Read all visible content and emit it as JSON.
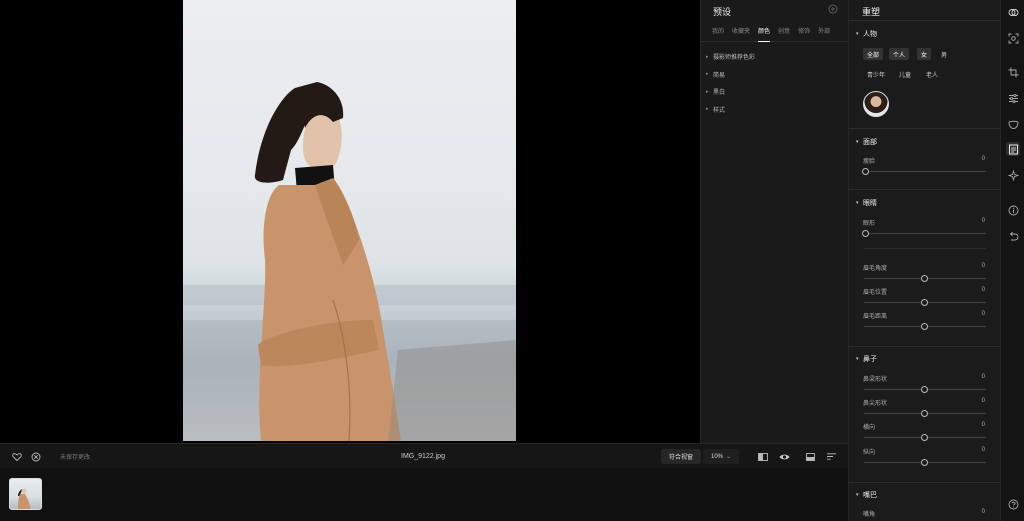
{
  "canvas": {
    "photo_desc_colors": {
      "coat": "#c8926a",
      "hair": "#231a15",
      "sky": "#e8ebed"
    }
  },
  "bottombar": {
    "heart_icon": "heart-icon",
    "reject_icon": "x-circle-icon",
    "unsaved_text": "未保存更改",
    "filename": "IMG_9122.jpg",
    "fit_label": "符合视窗",
    "zoom_label": "10%",
    "zoom_caret": "⌄"
  },
  "presets": {
    "title": "预设",
    "tabs": [
      {
        "label": "我的"
      },
      {
        "label": "收藏夹"
      },
      {
        "label": "颜色"
      },
      {
        "label": "创意"
      },
      {
        "label": "修饰"
      },
      {
        "label": "外部"
      }
    ],
    "items": [
      {
        "label": "摄影师推荐色彩"
      },
      {
        "label": "简易"
      },
      {
        "label": "黑白"
      },
      {
        "label": "样式"
      }
    ]
  },
  "adjust": {
    "title": "重塑",
    "people": {
      "title": "人物",
      "chips_row1": [
        "全部",
        "个人",
        "女",
        "男"
      ],
      "chips_row2": [
        "青少年",
        "儿童",
        "老人"
      ]
    },
    "face": {
      "title": "面部",
      "rows": [
        {
          "label": "瘦脸",
          "value": "0"
        }
      ]
    },
    "eyes": {
      "title": "眼睛",
      "rows": [
        {
          "label": "眼形",
          "value": "0"
        },
        {
          "label": "眉毛角度",
          "value": "0"
        },
        {
          "label": "眉毛位置",
          "value": "0"
        },
        {
          "label": "眉毛距离",
          "value": "0"
        }
      ]
    },
    "nose": {
      "title": "鼻子",
      "rows": [
        {
          "label": "鼻梁形状",
          "value": "0"
        },
        {
          "label": "鼻尖形状",
          "value": "0"
        },
        {
          "label": "横向",
          "value": "0"
        },
        {
          "label": "纵向",
          "value": "0"
        }
      ]
    },
    "mouth": {
      "title": "嘴巴",
      "rows": [
        {
          "label": "嘴角",
          "value": "0"
        }
      ]
    }
  },
  "rail": {
    "icons": [
      "layers-icon",
      "crop-face-icon",
      "crop-icon",
      "sliders-icon",
      "mask-icon",
      "portrait-frame-icon",
      "sparkle-icon",
      "info-icon",
      "undo-icon",
      "help-icon"
    ]
  }
}
